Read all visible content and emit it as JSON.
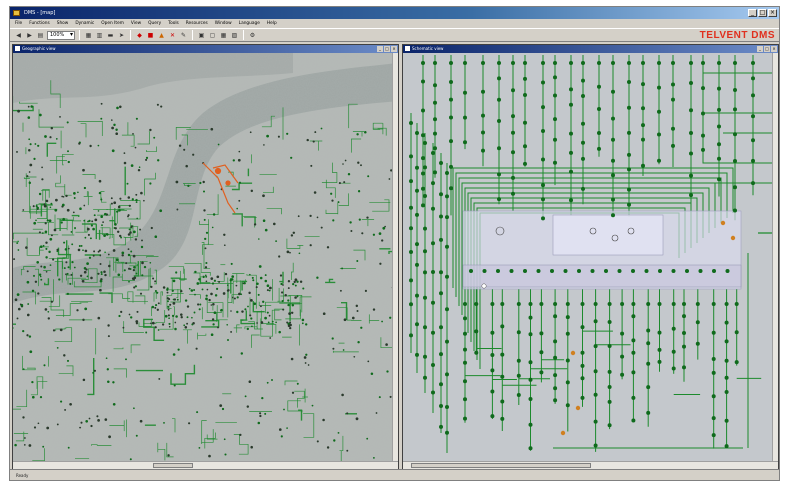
{
  "window": {
    "title": "DMS - [map]",
    "controls": [
      "_",
      "□",
      "×"
    ]
  },
  "menu": [
    "File",
    "Functions",
    "Show",
    "Dynamic",
    "Open Item",
    "View",
    "Query",
    "Tools",
    "Resources",
    "Window",
    "Language",
    "Help"
  ],
  "toolbar": {
    "zoom_value": "100%",
    "brand": "TELVENT DMS"
  },
  "left_panel": {
    "title": "Geographic view"
  },
  "right_panel": {
    "title": "Schematic view"
  },
  "status": {
    "left": "Ready",
    "middle": ""
  },
  "colors": {
    "network": "#1c8a2c",
    "node": "#0f6a1c",
    "highlight": "#e06020",
    "schematic_bg": "#c4c8cc",
    "overlay": "#dcdcf0"
  }
}
